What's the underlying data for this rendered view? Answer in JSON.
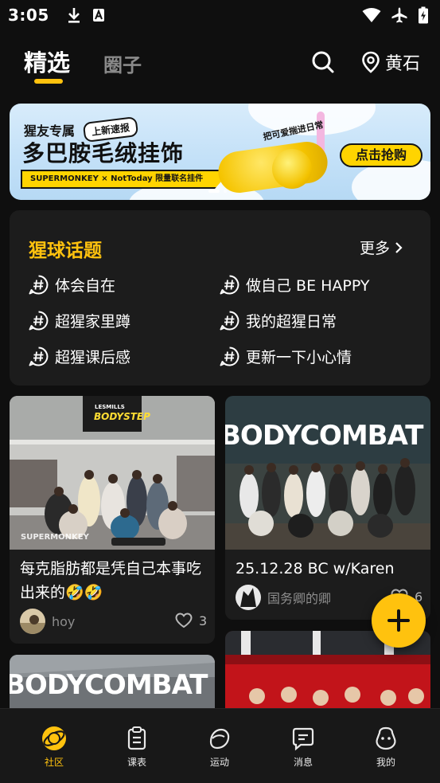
{
  "status_bar": {
    "time": "3:05"
  },
  "header": {
    "tabs": [
      {
        "label": "精选",
        "active": true
      },
      {
        "label": "圈子",
        "active": false
      }
    ],
    "location": "黄石"
  },
  "banner": {
    "kicker": "猩友专属",
    "tag": "上新速报",
    "title": "多巴胺毛绒挂饰",
    "strip": "SUPERMONKEY × NotToday 限量联名挂件",
    "script": "把可爱揣进日常",
    "cta": "点击抢购"
  },
  "topics": {
    "title": "猩球话题",
    "more": "更多",
    "items": [
      {
        "label": "体会自在"
      },
      {
        "label": "做自己 BE HAPPY"
      },
      {
        "label": "超猩家里蹲"
      },
      {
        "label": "我的超猩日常"
      },
      {
        "label": "超猩课后感"
      },
      {
        "label": "更新一下小心情"
      }
    ]
  },
  "feed": {
    "posts": [
      {
        "title": "每克脂肪都是凭自己本事吃出来的🤣🤣",
        "author": "hoy",
        "likes": "3",
        "image_text": "BODYSTEP",
        "image_brand": "SUPERMONKEY",
        "image_logo": "LESMILLS"
      },
      {
        "title": "25.12.28 BC w/Karen",
        "author": "国务卿的卿",
        "likes": "6",
        "image_text": "BODYCOMBAT"
      },
      {
        "title": "",
        "author": "",
        "likes": "",
        "image_text": "BODYCOMBAT"
      },
      {
        "title": "",
        "author": "",
        "likes": ""
      }
    ]
  },
  "bottom_nav": {
    "items": [
      {
        "label": "社区",
        "active": true
      },
      {
        "label": "课表",
        "active": false
      },
      {
        "label": "运动",
        "active": false
      },
      {
        "label": "消息",
        "active": false
      },
      {
        "label": "我的",
        "active": false
      }
    ]
  },
  "colors": {
    "accent": "#ffc20e",
    "background": "#0f0f0f",
    "card": "#1c1c1c"
  }
}
